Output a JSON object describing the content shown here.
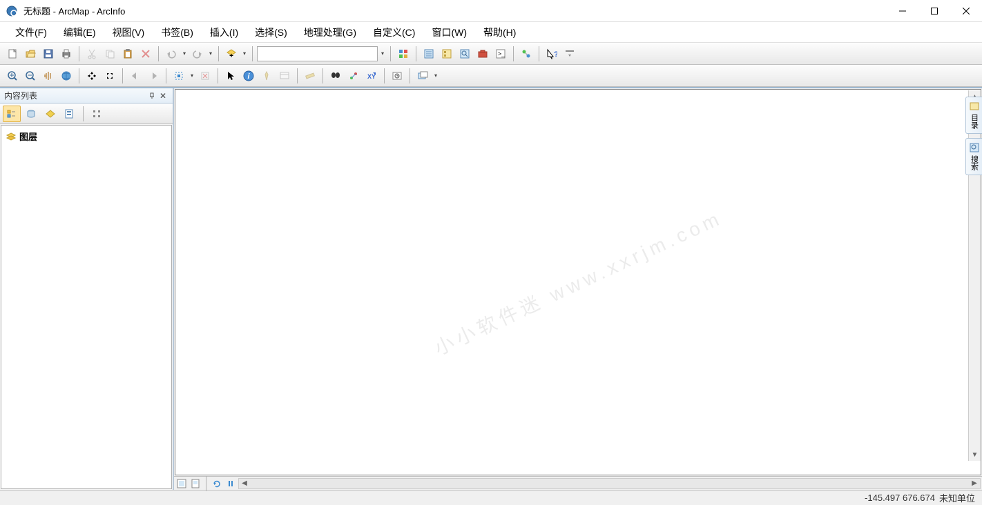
{
  "window": {
    "title": "无标题 - ArcMap - ArcInfo"
  },
  "menu": [
    "文件(F)",
    "编辑(E)",
    "视图(V)",
    "书签(B)",
    "插入(I)",
    "选择(S)",
    "地理处理(G)",
    "自定义(C)",
    "窗口(W)",
    "帮助(H)"
  ],
  "toolbar1": {
    "scale_value": ""
  },
  "toc_panel": {
    "title": "内容列表",
    "root_label": "图层"
  },
  "right_tabs": {
    "catalog": "目录",
    "search": "搜索"
  },
  "watermark": "小小软件迷 www.xxrjm.com",
  "status": {
    "coords": "-145.497  676.674",
    "units": "未知单位"
  }
}
